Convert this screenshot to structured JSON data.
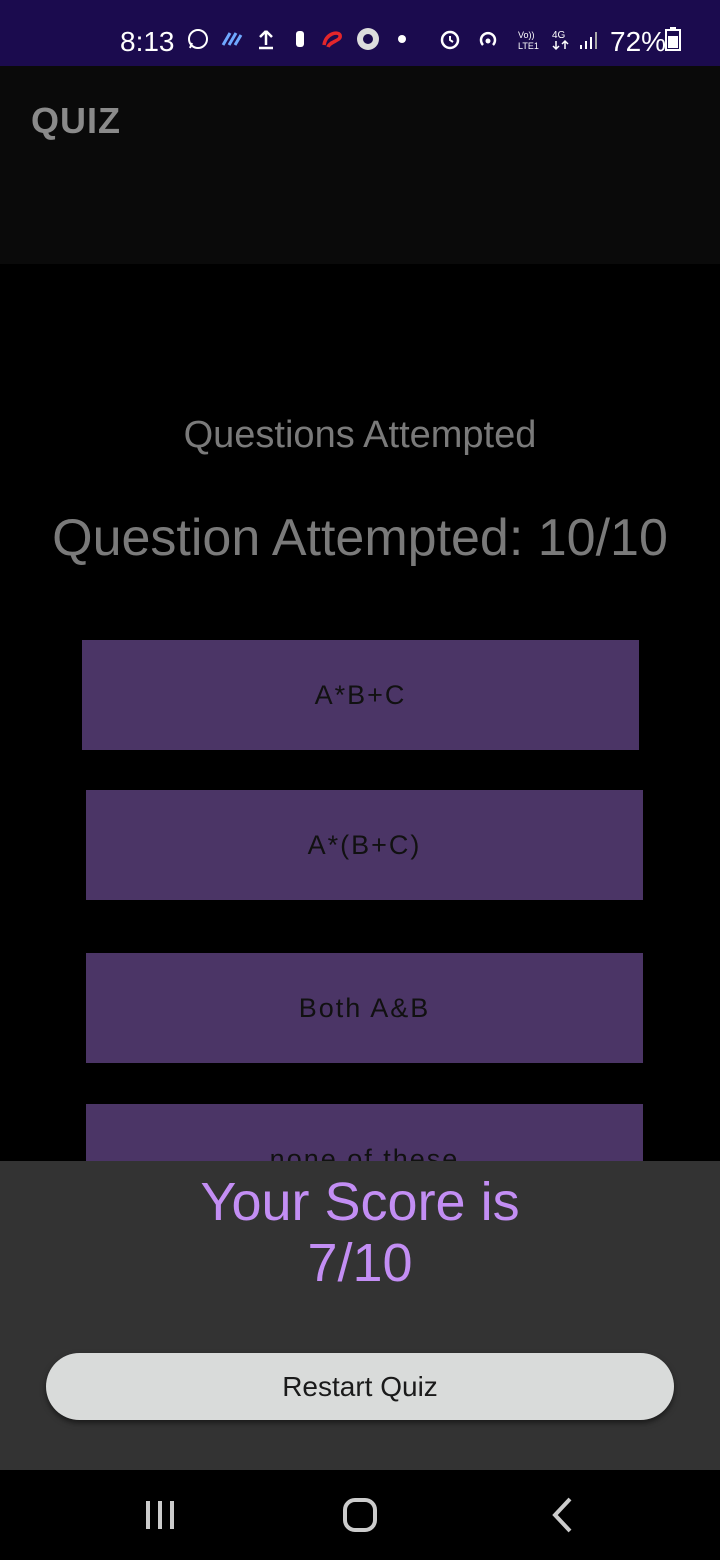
{
  "status_bar": {
    "time": "8:13",
    "battery": "72%",
    "icons": [
      "whatsapp-icon",
      "app-icon",
      "upload-icon",
      "notification-icon",
      "airtel-icon",
      "media-icon",
      "dot-icon",
      "alarm-icon",
      "hotspot-icon",
      "volte-icon",
      "4g-icon",
      "signal-icon",
      "battery-icon"
    ]
  },
  "app_bar": {
    "title": "QUIZ"
  },
  "main": {
    "subtitle": "Questions Attempted",
    "attempted": "Question Attempted: 10/10",
    "options": [
      "A*B+C",
      "A*(B+C)",
      "Both A&B",
      "none of these"
    ]
  },
  "result": {
    "score_line1": "Your Score is",
    "score_line2": "7/10",
    "restart_label": "Restart Quiz"
  },
  "colors": {
    "status_bar": "#1b0b4e",
    "option_bg": "#4b3566",
    "score_text": "#c38ef4",
    "sheet_bg": "#333333",
    "button_bg": "#d9dbda"
  },
  "nav": {
    "icons": [
      "recents-icon",
      "home-icon",
      "back-icon"
    ]
  }
}
